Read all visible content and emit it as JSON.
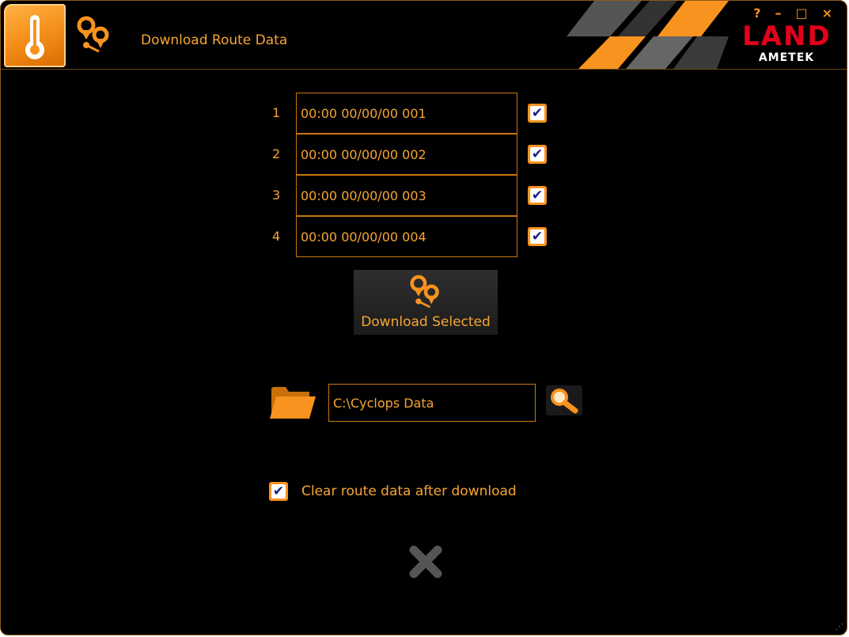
{
  "window": {
    "title": "Download Route Data",
    "controls": {
      "help": "?",
      "minimize": "–",
      "maximize": "□",
      "close": "×"
    },
    "logo": {
      "brand": "LAND",
      "sub": "AMETEK"
    }
  },
  "routes": [
    {
      "number": "1",
      "value": "00:00 00/00/00 001",
      "checked": true
    },
    {
      "number": "2",
      "value": "00:00 00/00/00 002",
      "checked": true
    },
    {
      "number": "3",
      "value": "00:00 00/00/00 003",
      "checked": true
    },
    {
      "number": "4",
      "value": "00:00 00/00/00 004",
      "checked": true
    }
  ],
  "download_button": {
    "label": "Download Selected",
    "icon": "route-pins-icon"
  },
  "folder": {
    "path": "C:\\Cyclops Data",
    "icon": "folder-icon",
    "browse_icon": "search-icon"
  },
  "options": {
    "clear_label": "Clear route data after download",
    "clear_checked": true
  },
  "checkmark": "✔",
  "colors": {
    "accent": "#f7931e",
    "text": "#f7a533",
    "background": "#000000",
    "logo_red": "#e3001b"
  }
}
